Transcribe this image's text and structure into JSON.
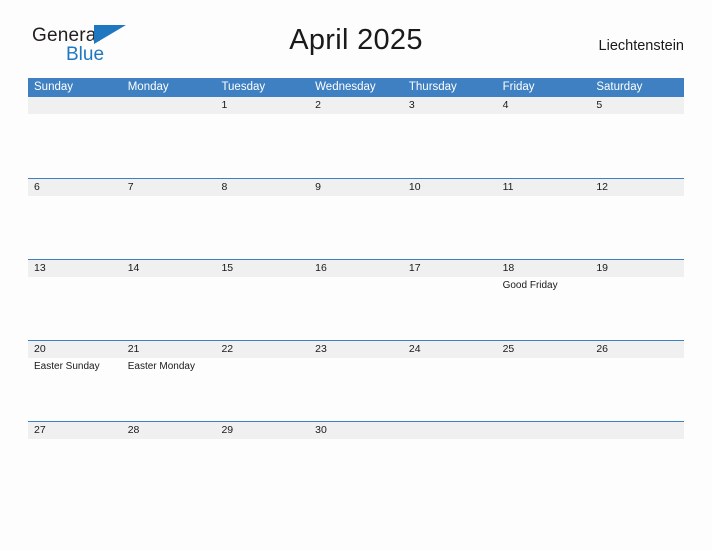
{
  "brand": {
    "name_part1": "General",
    "name_part2": "Blue",
    "triangle_color": "#1f77bf"
  },
  "header": {
    "title": "April 2025",
    "region": "Liechtenstein"
  },
  "calendar": {
    "accent_color": "#3e80c1",
    "band_color": "#f0f0f0",
    "weekdays": [
      "Sunday",
      "Monday",
      "Tuesday",
      "Wednesday",
      "Thursday",
      "Friday",
      "Saturday"
    ],
    "weeks": [
      [
        {
          "day": "",
          "events": []
        },
        {
          "day": "",
          "events": []
        },
        {
          "day": "1",
          "events": []
        },
        {
          "day": "2",
          "events": []
        },
        {
          "day": "3",
          "events": []
        },
        {
          "day": "4",
          "events": []
        },
        {
          "day": "5",
          "events": []
        }
      ],
      [
        {
          "day": "6",
          "events": []
        },
        {
          "day": "7",
          "events": []
        },
        {
          "day": "8",
          "events": []
        },
        {
          "day": "9",
          "events": []
        },
        {
          "day": "10",
          "events": []
        },
        {
          "day": "11",
          "events": []
        },
        {
          "day": "12",
          "events": []
        }
      ],
      [
        {
          "day": "13",
          "events": []
        },
        {
          "day": "14",
          "events": []
        },
        {
          "day": "15",
          "events": []
        },
        {
          "day": "16",
          "events": []
        },
        {
          "day": "17",
          "events": []
        },
        {
          "day": "18",
          "events": [
            "Good Friday"
          ]
        },
        {
          "day": "19",
          "events": []
        }
      ],
      [
        {
          "day": "20",
          "events": [
            "Easter Sunday"
          ]
        },
        {
          "day": "21",
          "events": [
            "Easter Monday"
          ]
        },
        {
          "day": "22",
          "events": []
        },
        {
          "day": "23",
          "events": []
        },
        {
          "day": "24",
          "events": []
        },
        {
          "day": "25",
          "events": []
        },
        {
          "day": "26",
          "events": []
        }
      ],
      [
        {
          "day": "27",
          "events": []
        },
        {
          "day": "28",
          "events": []
        },
        {
          "day": "29",
          "events": []
        },
        {
          "day": "30",
          "events": []
        },
        {
          "day": "",
          "events": []
        },
        {
          "day": "",
          "events": []
        },
        {
          "day": "",
          "events": []
        }
      ]
    ]
  }
}
